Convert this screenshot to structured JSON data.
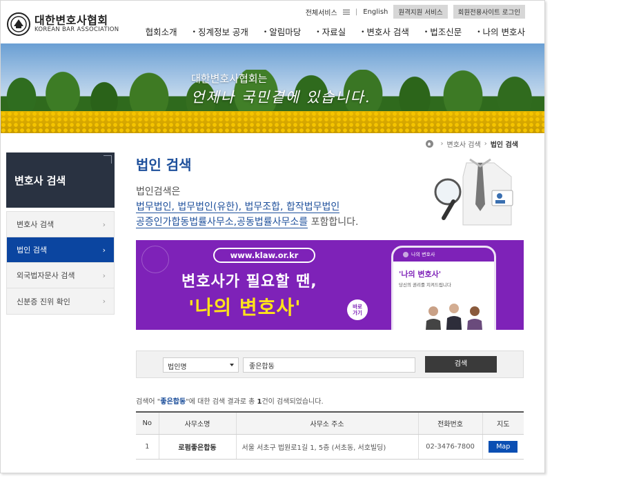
{
  "header": {
    "logo_ko": "대한변호사협회",
    "logo_en": "KOREAN BAR ASSOCIATION",
    "util": {
      "all_services": "전체서비스",
      "english": "English",
      "remote_support": "원격지원 서비스",
      "member_login": "회원전용사이트 로그인"
    },
    "gnb": [
      "협회소개",
      "징계정보 공개",
      "알림마당",
      "자료실",
      "변호사 검색",
      "법조신문",
      "나의 변호사"
    ]
  },
  "hero": {
    "line1": "대한변호사협회는",
    "line2": "언제나 국민곁에 있습니다."
  },
  "breadcrumb": {
    "parent": "변호사 검색",
    "current": "법인 검색"
  },
  "sidebar": {
    "title": "변호사 검색",
    "items": [
      {
        "label": "변호사 검색",
        "active": false
      },
      {
        "label": "법인 검색",
        "active": true
      },
      {
        "label": "외국법자문사 검색",
        "active": false
      },
      {
        "label": "신분증 진위 확인",
        "active": false
      }
    ]
  },
  "page": {
    "title": "법인 검색",
    "intro_line1": "법인검색은",
    "intro_line2": "법무법인, 법무법인(유한), 법무조합, 합작법무법인",
    "intro_line3a": "공증인가합동법률사무소,공동법률사무소를",
    "intro_line3b": " 포함합니다."
  },
  "banner": {
    "url": "www.klaw.or.kr",
    "headline1": "변호사가 필요할 땐,",
    "headline2": "'나의 변호사'",
    "go_line1": "바로",
    "go_line2": "가기",
    "phone_app": "나의 변호사",
    "phone_title": "'나의 변호사'",
    "phone_sub": "당신의 권리를 지켜드립니다"
  },
  "search": {
    "select_value": "법인명",
    "input_value": "좋은합동",
    "button": "검색"
  },
  "result": {
    "prefix": "검색어 \"",
    "keyword": "좋은합동",
    "middle": "\"에 대한 검색 결과로 총 ",
    "count": "1",
    "suffix": "건이 검색되었습니다."
  },
  "table": {
    "headers": [
      "No",
      "사무소명",
      "사무소 주소",
      "전화번호",
      "지도"
    ],
    "rows": [
      {
        "no": "1",
        "name": "로펌좋은합동",
        "address": "서울 서초구 법원로1길 1, 5층 (서초동, 서호빌딩)",
        "phone": "02-3476-7800",
        "map": "Map"
      }
    ]
  },
  "colors": {
    "brand_blue": "#1d4f9b",
    "active_nav": "#0b45a0",
    "sidebar_header": "#293241",
    "banner_purple": "#7e22b8",
    "banner_yellow": "#ffe31a"
  }
}
